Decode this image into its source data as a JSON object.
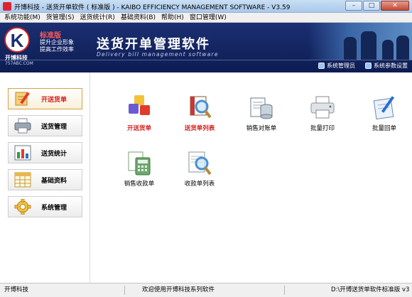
{
  "window": {
    "title": "开博科技 - 送货开单软件 ( 标准版 )        - KAIBO EFFICIENCY MANAGEMENT SOFTWARE - V3.59",
    "controls": {
      "minimize": "–",
      "maximize": "□",
      "close": "✕"
    }
  },
  "menu": [
    "系统功能(M)",
    "货管理(S)",
    "送货统计(R)",
    "基础资料(B)",
    "帮助(H)",
    "窗口管理(W)"
  ],
  "banner": {
    "edition": "标准版",
    "slogan_line1": "提升企业形象",
    "slogan_line2": "提高工作效率",
    "company": "开博科技",
    "site": "757ABC.COM",
    "app_name": "送货开单管理软件",
    "app_subtitle": "Delivery bill management software",
    "links": [
      {
        "label": "系统管理员",
        "icon": "user-icon"
      },
      {
        "label": "系统参数设置",
        "icon": "monitor-icon"
      }
    ]
  },
  "nav": [
    {
      "label": "开送货单",
      "icon": "pencil-notepad-icon",
      "active": true
    },
    {
      "label": "送货管理",
      "icon": "printer-icon",
      "active": false
    },
    {
      "label": "送货统计",
      "icon": "bar-chart-icon",
      "active": false
    },
    {
      "label": "基础资料",
      "icon": "calendar-grid-icon",
      "active": false
    },
    {
      "label": "系统管理",
      "icon": "gear-icon",
      "active": false
    }
  ],
  "tiles": [
    {
      "label": "开送货单",
      "icon": "cubes-icon",
      "highlight": true
    },
    {
      "label": "送货单列表",
      "icon": "magnifier-book-icon",
      "highlight": true
    },
    {
      "label": "销售对账单",
      "icon": "document-database-icon",
      "highlight": false
    },
    {
      "label": "批量打印",
      "icon": "printer-icon",
      "highlight": false
    },
    {
      "label": "批量回单",
      "icon": "pen-paper-icon",
      "highlight": false
    },
    {
      "label": "销售收款单",
      "icon": "calculator-icon",
      "highlight": false
    },
    {
      "label": "收款单列表",
      "icon": "magnifier-list-icon",
      "highlight": false
    }
  ],
  "status": {
    "left": "开博科技",
    "center": "欢迎使用开博科技系列软件",
    "right": "D:\\开博送货单软件标准版 v3"
  },
  "colors": {
    "banner": "#1b2f72",
    "accent_red": "#d11d1d",
    "titlebar": "#b9d3ee"
  }
}
